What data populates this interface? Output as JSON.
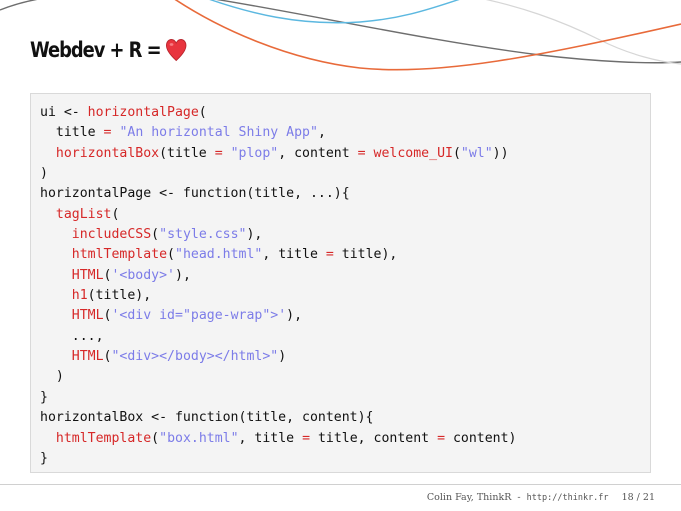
{
  "slide": {
    "title": "Webdev + R =",
    "title_emoji": "heart-emoji"
  },
  "code": {
    "lines": [
      [
        {
          "t": "ui <- ",
          "c": ""
        },
        {
          "t": "horizontalPage",
          "c": "fn"
        },
        {
          "t": "(",
          "c": ""
        }
      ],
      [
        {
          "t": "  title ",
          "c": ""
        },
        {
          "t": "=",
          "c": "op"
        },
        {
          "t": " ",
          "c": ""
        },
        {
          "t": "\"An horizontal Shiny App\"",
          "c": "str"
        },
        {
          "t": ",",
          "c": ""
        }
      ],
      [
        {
          "t": "  ",
          "c": ""
        },
        {
          "t": "horizontalBox",
          "c": "fn"
        },
        {
          "t": "(title ",
          "c": ""
        },
        {
          "t": "=",
          "c": "op"
        },
        {
          "t": " ",
          "c": ""
        },
        {
          "t": "\"plop\"",
          "c": "str"
        },
        {
          "t": ", content ",
          "c": ""
        },
        {
          "t": "=",
          "c": "op"
        },
        {
          "t": " ",
          "c": ""
        },
        {
          "t": "welcome_UI",
          "c": "fn"
        },
        {
          "t": "(",
          "c": ""
        },
        {
          "t": "\"wl\"",
          "c": "str"
        },
        {
          "t": "))",
          "c": ""
        }
      ],
      [
        {
          "t": ")",
          "c": ""
        }
      ],
      [
        {
          "t": "horizontalPage <- function(title, ...){",
          "c": ""
        }
      ],
      [
        {
          "t": "  ",
          "c": ""
        },
        {
          "t": "tagList",
          "c": "fn"
        },
        {
          "t": "(",
          "c": ""
        }
      ],
      [
        {
          "t": "    ",
          "c": ""
        },
        {
          "t": "includeCSS",
          "c": "fn"
        },
        {
          "t": "(",
          "c": ""
        },
        {
          "t": "\"style.css\"",
          "c": "str"
        },
        {
          "t": "),",
          "c": ""
        }
      ],
      [
        {
          "t": "    ",
          "c": ""
        },
        {
          "t": "htmlTemplate",
          "c": "fn"
        },
        {
          "t": "(",
          "c": ""
        },
        {
          "t": "\"head.html\"",
          "c": "str"
        },
        {
          "t": ", title ",
          "c": ""
        },
        {
          "t": "=",
          "c": "op"
        },
        {
          "t": " title),",
          "c": ""
        }
      ],
      [
        {
          "t": "    ",
          "c": ""
        },
        {
          "t": "HTML",
          "c": "fn"
        },
        {
          "t": "(",
          "c": ""
        },
        {
          "t": "'<body>'",
          "c": "str"
        },
        {
          "t": "),",
          "c": ""
        }
      ],
      [
        {
          "t": "    ",
          "c": ""
        },
        {
          "t": "h1",
          "c": "fn"
        },
        {
          "t": "(title),",
          "c": ""
        }
      ],
      [
        {
          "t": "    ",
          "c": ""
        },
        {
          "t": "HTML",
          "c": "fn"
        },
        {
          "t": "(",
          "c": ""
        },
        {
          "t": "'<div id=\"page-wrap\">'",
          "c": "str"
        },
        {
          "t": "),",
          "c": ""
        }
      ],
      [
        {
          "t": "    ...,",
          "c": ""
        }
      ],
      [
        {
          "t": "    ",
          "c": ""
        },
        {
          "t": "HTML",
          "c": "fn"
        },
        {
          "t": "(",
          "c": ""
        },
        {
          "t": "\"<div></body></html>\"",
          "c": "str"
        },
        {
          "t": ")",
          "c": ""
        }
      ],
      [
        {
          "t": "  )",
          "c": ""
        }
      ],
      [
        {
          "t": "}",
          "c": ""
        }
      ],
      [
        {
          "t": "horizontalBox <- function(title, content){",
          "c": ""
        }
      ],
      [
        {
          "t": "  ",
          "c": ""
        },
        {
          "t": "htmlTemplate",
          "c": "fn"
        },
        {
          "t": "(",
          "c": ""
        },
        {
          "t": "\"box.html\"",
          "c": "str"
        },
        {
          "t": ", title ",
          "c": ""
        },
        {
          "t": "=",
          "c": "op"
        },
        {
          "t": " title, content ",
          "c": ""
        },
        {
          "t": "=",
          "c": "op"
        },
        {
          "t": " content)",
          "c": ""
        }
      ],
      [
        {
          "t": "}",
          "c": ""
        }
      ]
    ]
  },
  "footer": {
    "author": "Colin Fay, ThinkR",
    "separator": "-",
    "url": "http://thinkr.fr",
    "page": "18 / 21"
  },
  "colors": {
    "function": "#d62828",
    "string": "#7c7ce8",
    "curve_gray": "#6e6e6e",
    "curve_blue": "#5cb8e0",
    "curve_orange": "#e86a3a",
    "heart": "#e8343e"
  }
}
